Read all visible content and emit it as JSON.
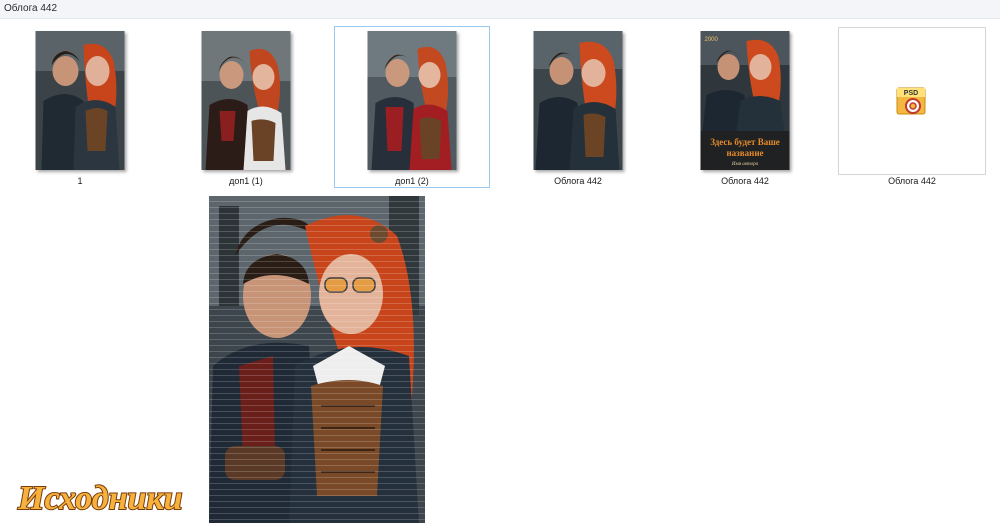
{
  "window": {
    "title": "Облога 442"
  },
  "files": [
    {
      "label": "1",
      "kind": "image"
    },
    {
      "label": "доп1 (1)",
      "kind": "image"
    },
    {
      "label": "доп1 (2)",
      "kind": "image",
      "selected": true
    },
    {
      "label": "Облога  442",
      "kind": "image"
    },
    {
      "label": "Облога 442",
      "kind": "cover"
    },
    {
      "label": "Облога 442",
      "kind": "psd"
    }
  ],
  "cover": {
    "corner_text": "2000",
    "line1": "Здесь будет Ваше",
    "line2": "название",
    "line3": "Имя автора"
  },
  "psd_icon": {
    "badge": "PSD"
  },
  "watermark": {
    "text": "Исходники"
  },
  "colors": {
    "accent_selection": "#99c9ef",
    "hair": "#c8451c",
    "watermark_fill": "#f6b23c"
  }
}
